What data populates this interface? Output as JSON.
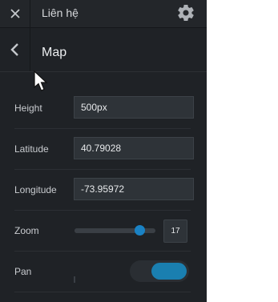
{
  "topbar": {
    "title": "Liên hệ",
    "close_icon": "close-icon",
    "settings_icon": "gear-icon"
  },
  "panel": {
    "back_icon": "chevron-left-icon",
    "section_title": "Map"
  },
  "fields": {
    "height": {
      "label": "Height",
      "value": "500px"
    },
    "latitude": {
      "label": "Latitude",
      "value": "40.79028"
    },
    "longitude": {
      "label": "Longitude",
      "value": "-73.95972"
    }
  },
  "zoom": {
    "label": "Zoom",
    "value": "17",
    "level_fraction": 0.8
  },
  "pan": {
    "label": "Pan",
    "enabled": true
  },
  "colors": {
    "accent": "#1a82c4",
    "panel_bg": "#1f2226"
  }
}
